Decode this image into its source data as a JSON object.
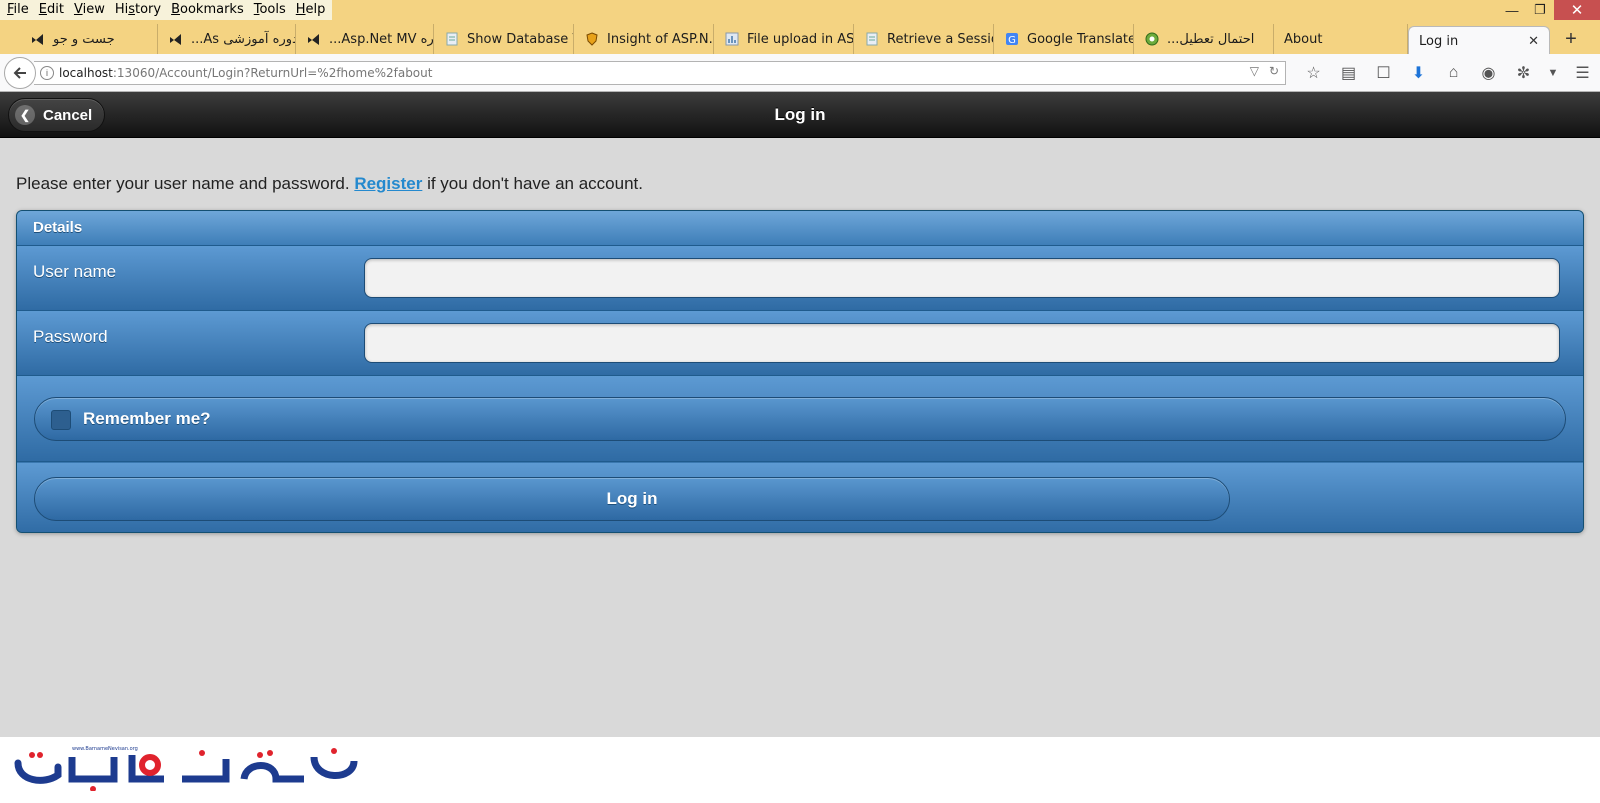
{
  "browser": {
    "menu": [
      {
        "pre": "",
        "u": "F",
        "post": "ile"
      },
      {
        "pre": "",
        "u": "E",
        "post": "dit"
      },
      {
        "pre": "",
        "u": "V",
        "post": "iew"
      },
      {
        "pre": "Hi",
        "u": "s",
        "post": "tory"
      },
      {
        "pre": "",
        "u": "B",
        "post": "ookmarks"
      },
      {
        "pre": "",
        "u": "T",
        "post": "ools"
      },
      {
        "pre": "",
        "u": "H",
        "post": "elp"
      }
    ],
    "tabs": [
      {
        "label": "جست و جو",
        "icon": "visual-studio-icon"
      },
      {
        "label": "دوره آموزشی As...",
        "icon": "visual-studio-icon"
      },
      {
        "label": "دوره Asp.Net MV...",
        "icon": "visual-studio-icon"
      },
      {
        "label": "Show Database V...",
        "icon": "page-icon"
      },
      {
        "label": "Insight of ASP.N...",
        "icon": "shield-icon"
      },
      {
        "label": "File upload in AS...",
        "icon": "chart-icon"
      },
      {
        "label": "Retrieve a Sessio...",
        "icon": "page-icon"
      },
      {
        "label": "Google Translate",
        "icon": "translate-icon"
      },
      {
        "label": "احتمال تعطيل...",
        "icon": "globe-icon"
      },
      {
        "label": "About",
        "icon": ""
      },
      {
        "label": "Log in",
        "icon": ""
      }
    ],
    "url": {
      "host": "localhost",
      "rest": ":13060/Account/Login?ReturnUrl=%2fhome%2fabout"
    }
  },
  "page": {
    "header_title": "Log in",
    "cancel_label": "Cancel",
    "intro_before": "Please enter your user name and password.",
    "register_link": "Register",
    "intro_after": "if you don't have an account.",
    "fieldset_legend": "Details",
    "username_label": "User name",
    "username_value": "",
    "password_label": "Password",
    "password_value": "",
    "remember_label": "Remember me?",
    "remember_checked": false,
    "login_button": "Log in"
  },
  "footer": {
    "logo_text": "برنامه نویسان",
    "logo_url": "www.BarnameNevisan.org"
  },
  "colors": {
    "accent": "#2489ce",
    "panel_blue": "#3a78b0",
    "logo_blue": "#1d3b8f",
    "logo_red": "#e0232d"
  }
}
